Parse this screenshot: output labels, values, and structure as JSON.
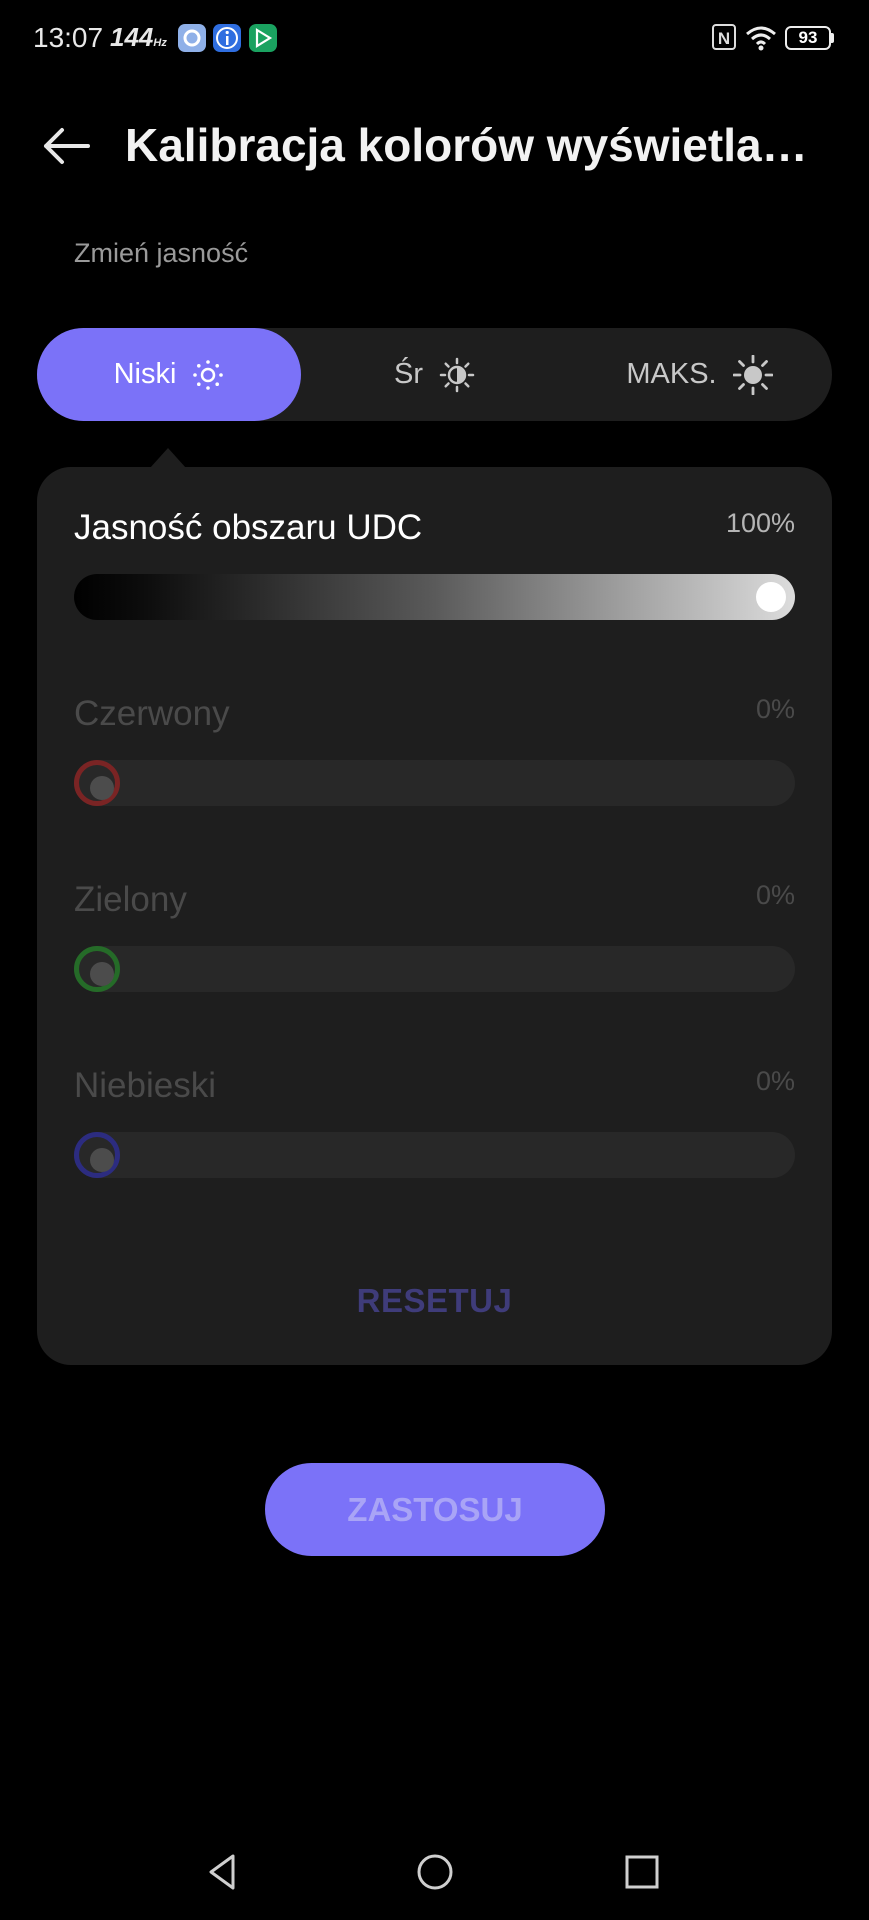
{
  "status_bar": {
    "time": "13:07",
    "refresh_rate": "144",
    "refresh_unit": "Hz",
    "battery": "93",
    "icons": [
      "settings-app-icon",
      "info-app-icon",
      "play-store-icon",
      "nfc-icon",
      "wifi-icon",
      "battery-icon"
    ]
  },
  "header": {
    "title": "Kalibracja kolorów wyświetla…",
    "back_icon": "back-arrow-icon"
  },
  "brightness": {
    "section_label": "Zmień jasność",
    "options": [
      {
        "label": "Niski",
        "icon": "sun-low-icon",
        "selected": true
      },
      {
        "label": "Śr",
        "icon": "sun-half-icon",
        "selected": false
      },
      {
        "label": "MAKS.",
        "icon": "sun-max-icon",
        "selected": false
      }
    ]
  },
  "sliders": [
    {
      "label": "Jasność obszaru UDC",
      "value_text": "100%",
      "value": 100,
      "enabled": true
    },
    {
      "label": "Czerwony",
      "value_text": "0%",
      "value": 0,
      "enabled": false,
      "color": "#a32a2a"
    },
    {
      "label": "Zielony",
      "value_text": "0%",
      "value": 0,
      "enabled": false,
      "color": "#2d8a32"
    },
    {
      "label": "Niebieski",
      "value_text": "0%",
      "value": 0,
      "enabled": false,
      "color": "#3a3aa0"
    }
  ],
  "reset_label": "RESETUJ",
  "apply_label": "ZASTOSUJ",
  "accent_color": "#7b72f8",
  "nav": {
    "back": "nav-back-icon",
    "home": "nav-home-icon",
    "recents": "nav-recents-icon"
  }
}
